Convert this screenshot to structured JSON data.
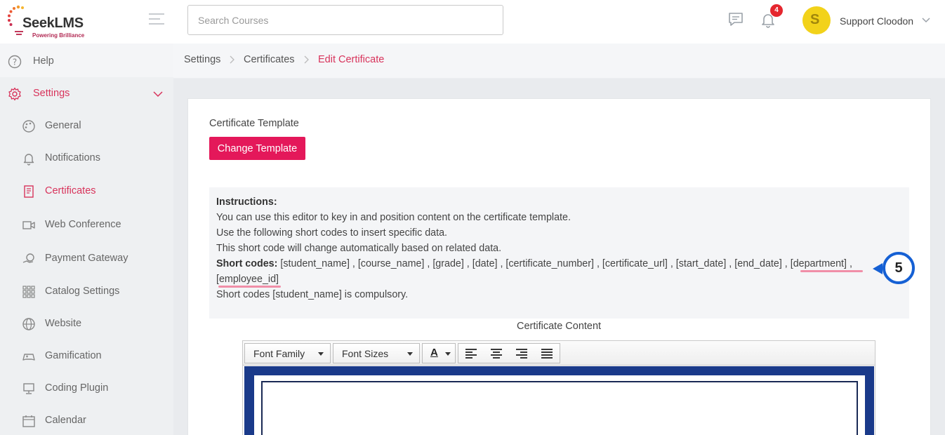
{
  "header": {
    "logo_brand_a": "Seek",
    "logo_brand_b": "LMS",
    "logo_tagline": "Powering Brilliance",
    "search_placeholder": "Search Courses",
    "notification_count": "4",
    "avatar_letter": "S",
    "user_name": "Support Cloodon"
  },
  "sidebar": {
    "help": "Help",
    "settings": "Settings",
    "items": [
      {
        "label": "General",
        "icon": "palette-icon"
      },
      {
        "label": "Notifications",
        "icon": "bell-icon"
      },
      {
        "label": "Certificates",
        "icon": "certificate-icon"
      },
      {
        "label": "Web Conference",
        "icon": "video-icon"
      },
      {
        "label": "Payment Gateway",
        "icon": "payment-icon"
      },
      {
        "label": "Catalog Settings",
        "icon": "grid-icon"
      },
      {
        "label": "Website",
        "icon": "globe-icon"
      },
      {
        "label": "Gamification",
        "icon": "gamepad-icon"
      },
      {
        "label": "Coding Plugin",
        "icon": "monitor-icon"
      },
      {
        "label": "Calendar",
        "icon": "calendar-icon"
      }
    ]
  },
  "breadcrumb": {
    "items": [
      "Settings",
      "Certificates",
      "Edit Certificate"
    ]
  },
  "main": {
    "template_label": "Certificate Template",
    "change_template_button": "Change Template",
    "instructions": {
      "heading": "Instructions:",
      "line1": "You can use this editor to key in and position content on the certificate template.",
      "line2": "Use the following short codes to insert specific data.",
      "line3": "This short code will change automatically based on related data.",
      "short_codes_label": "Short codes:",
      "short_codes_text": " [student_name] , [course_name] , [grade] , [date] , [certificate_number] , [certificate_url] , [start_date] , [end_date] , ",
      "code_department": "[department]",
      "code_sep": " ,",
      "code_employee": "[employee_id]",
      "compulsory_note": "Short codes [student_name] is compulsory."
    },
    "step_number": "5",
    "content_label": "Certificate Content",
    "editor": {
      "font_family_label": "Font Family",
      "font_sizes_label": "Font Sizes",
      "text_color_glyph": "A"
    }
  },
  "colors": {
    "accent": "#e4185a",
    "active_text": "#d8335b",
    "step_blue": "#1560d4",
    "certificate_border": "#1a3a8a"
  }
}
